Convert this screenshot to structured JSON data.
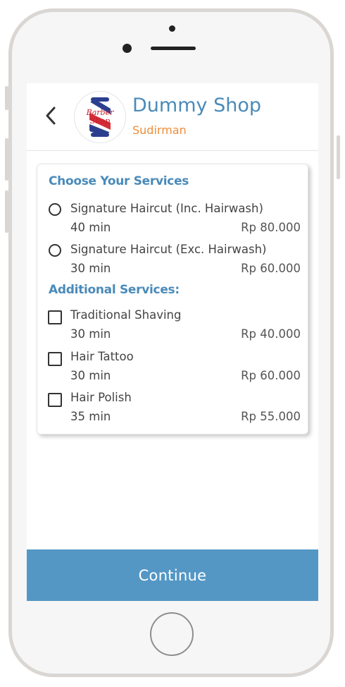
{
  "header": {
    "shop_name": "Dummy Shop",
    "branch": "Sudirman",
    "logo_text_line1": "Barber",
    "logo_text_line2": "Shop"
  },
  "services": {
    "title": "Choose Your Services",
    "items": [
      {
        "name": "Signature Haircut (Inc. Hairwash)",
        "duration": "40 min",
        "price": "Rp 80.000"
      },
      {
        "name": "Signature Haircut (Exc. Hairwash)",
        "duration": "30 min",
        "price": "Rp 60.000"
      }
    ]
  },
  "additional": {
    "title": "Additional Services:",
    "items": [
      {
        "name": "Traditional Shaving",
        "duration": "30 min",
        "price": "Rp 40.000"
      },
      {
        "name": "Hair Tattoo",
        "duration": "30 min",
        "price": "Rp 60.000"
      },
      {
        "name": "Hair Polish",
        "duration": "35 min",
        "price": "Rp 55.000"
      }
    ]
  },
  "footer": {
    "continue_label": "Continue"
  },
  "colors": {
    "accent": "#4a8ab9",
    "branch": "#ef8d3a",
    "button": "#5497c5"
  },
  "icons": {
    "back": "chevron-left-icon",
    "logo": "barber-pole-logo"
  }
}
